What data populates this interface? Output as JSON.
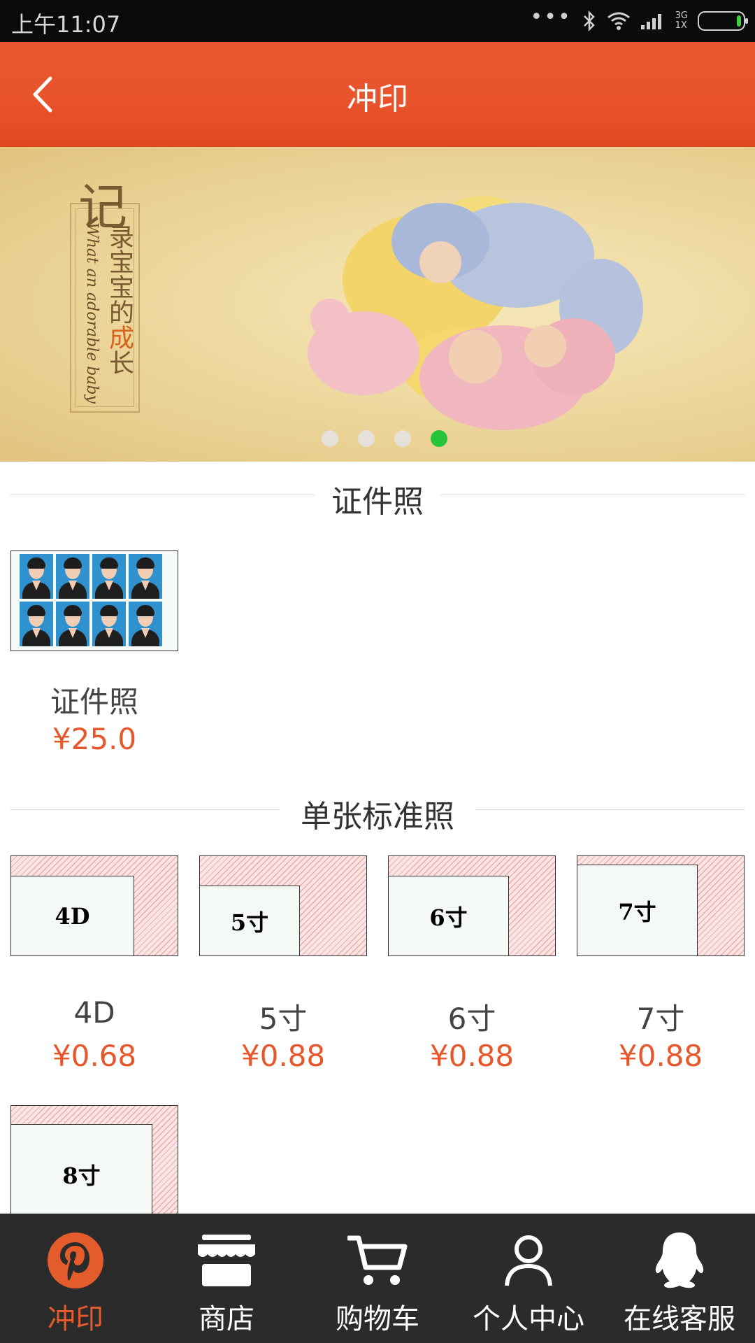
{
  "status_bar": {
    "time": "上午11:07",
    "dots": "•••",
    "network_top": "3G",
    "network_bottom": "1X"
  },
  "header": {
    "title": "冲印"
  },
  "banner": {
    "big_char": "记",
    "vertical_text_1": "录宝宝的",
    "vertical_text_highlight": "成",
    "vertical_text_2": "长",
    "script_text": "What an adorable baby",
    "dot_count": 4,
    "active_dot": 4
  },
  "sections": {
    "id_photo": {
      "title": "证件照",
      "products": [
        {
          "name": "证件照",
          "price": "¥25.0"
        }
      ]
    },
    "standard": {
      "title": "单张标准照",
      "products": [
        {
          "name": "4D",
          "price": "¥0.68",
          "thumb_label": "4D"
        },
        {
          "name": "5寸",
          "price": "¥0.88",
          "thumb_label": "5寸"
        },
        {
          "name": "6寸",
          "price": "¥0.88",
          "thumb_label": "6寸"
        },
        {
          "name": "7寸",
          "price": "¥0.88",
          "thumb_label": "7寸"
        },
        {
          "thumb_label": "8寸"
        }
      ]
    }
  },
  "bottom_nav": [
    {
      "label": "冲印",
      "icon": "pinterest-icon",
      "active": true
    },
    {
      "label": "商店",
      "icon": "store-icon"
    },
    {
      "label": "购物车",
      "icon": "cart-icon"
    },
    {
      "label": "个人中心",
      "icon": "user-icon"
    },
    {
      "label": "在线客服",
      "icon": "qq-penguin-icon"
    }
  ],
  "colors": {
    "accent": "#e8532c",
    "price": "#e8562b",
    "nav_bg": "#2b2b2b",
    "active_dot": "#27c43a"
  }
}
